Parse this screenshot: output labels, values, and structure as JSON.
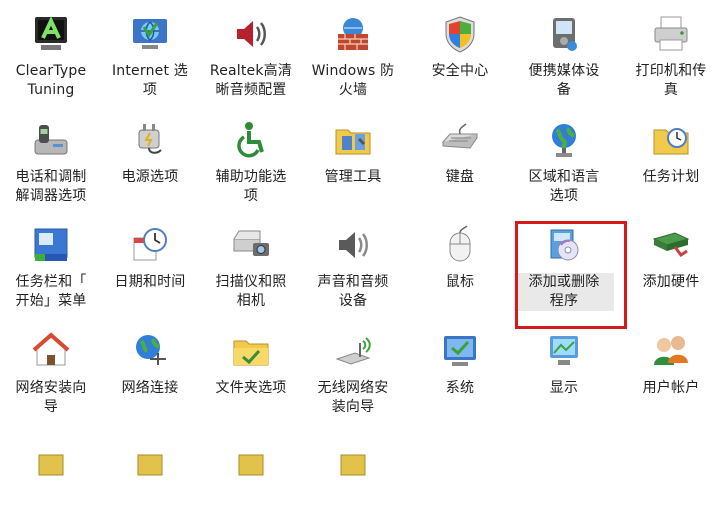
{
  "window": {
    "title": ""
  },
  "control_panel": {
    "highlight_color": "#d41a1a",
    "selected_item": "add-remove-programs",
    "rows": [
      [
        {
          "id": "cleartype",
          "label": "ClearType\nTuning",
          "icon": "cleartype-icon"
        },
        {
          "id": "internet-options",
          "label": "Internet 选\n项",
          "icon": "internet-options-icon"
        },
        {
          "id": "realtek-audio",
          "label": "Realtek高清\n晰音频配置",
          "icon": "speaker-icon"
        },
        {
          "id": "windows-firewall",
          "label": "Windows 防\n火墙",
          "icon": "firewall-icon"
        },
        {
          "id": "security-center",
          "label": "安全中心",
          "icon": "shield-icon"
        },
        {
          "id": "portable-devices",
          "label": "便携媒体设\n备",
          "icon": "portable-device-icon"
        },
        {
          "id": "printers-fax",
          "label": "打印机和传\n真",
          "icon": "printer-icon"
        }
      ],
      [
        {
          "id": "phone-modem",
          "label": "电话和调制\n解调器选项",
          "icon": "phone-icon"
        },
        {
          "id": "power-options",
          "label": "电源选项",
          "icon": "power-icon"
        },
        {
          "id": "accessibility",
          "label": "辅助功能选\n项",
          "icon": "accessibility-icon"
        },
        {
          "id": "admin-tools",
          "label": "管理工具",
          "icon": "admin-tools-icon"
        },
        {
          "id": "keyboard",
          "label": "键盘",
          "icon": "keyboard-icon"
        },
        {
          "id": "regional-language",
          "label": "区域和语言\n选项",
          "icon": "globe-icon"
        },
        {
          "id": "scheduled-tasks",
          "label": "任务计划",
          "icon": "scheduled-tasks-icon"
        }
      ],
      [
        {
          "id": "taskbar-start",
          "label": "任务栏和「\n开始」菜单",
          "icon": "taskbar-icon"
        },
        {
          "id": "date-time",
          "label": "日期和时间",
          "icon": "clock-icon"
        },
        {
          "id": "scanners-cameras",
          "label": "扫描仪和照\n相机",
          "icon": "scanner-camera-icon"
        },
        {
          "id": "sounds-audio",
          "label": "声音和音频\n设备",
          "icon": "sound-icon"
        },
        {
          "id": "mouse",
          "label": "鼠标",
          "icon": "mouse-icon"
        },
        {
          "id": "add-remove-programs",
          "label": "添加或删除\n程序",
          "icon": "add-remove-programs-icon"
        },
        {
          "id": "add-hardware",
          "label": "添加硬件",
          "icon": "hardware-icon"
        }
      ],
      [
        {
          "id": "network-setup",
          "label": "网络安装向\n导",
          "icon": "network-setup-icon"
        },
        {
          "id": "network-connections",
          "label": "网络连接",
          "icon": "network-connections-icon"
        },
        {
          "id": "folder-options",
          "label": "文件夹选项",
          "icon": "folder-icon"
        },
        {
          "id": "wireless-setup",
          "label": "无线网络安\n装向导",
          "icon": "wireless-icon"
        },
        {
          "id": "system",
          "label": "系统",
          "icon": "system-icon"
        },
        {
          "id": "display",
          "label": "显示",
          "icon": "display-icon"
        },
        {
          "id": "user-accounts",
          "label": "用户帐户",
          "icon": "users-icon"
        }
      ],
      [
        {
          "id": "partial-1",
          "label": "",
          "icon": "partial-icon"
        },
        {
          "id": "partial-2",
          "label": "",
          "icon": "partial-icon"
        },
        {
          "id": "partial-3",
          "label": "",
          "icon": "partial-icon"
        },
        {
          "id": "partial-4",
          "label": "",
          "icon": "partial-icon"
        }
      ]
    ]
  }
}
